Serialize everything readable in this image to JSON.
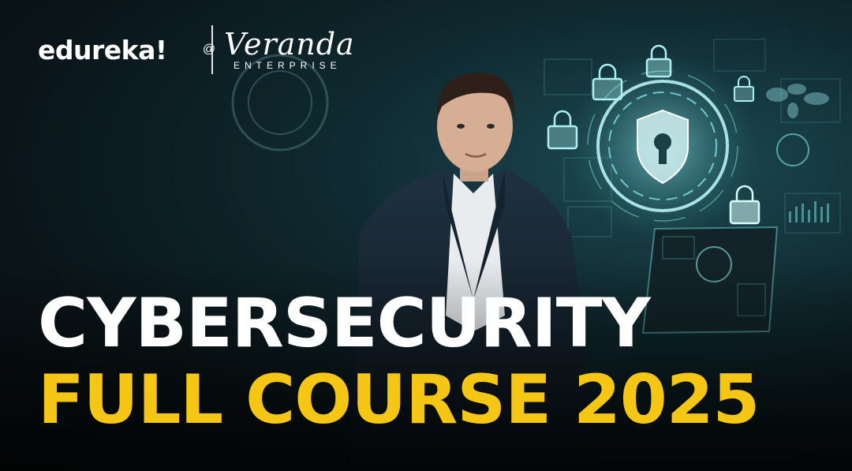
{
  "logos": {
    "edureka": "edureka!",
    "at_symbol": "@",
    "veranda": "Veranda",
    "enterprise": "ENTERPRISE"
  },
  "headline": {
    "line1": "CYBERSECURITY",
    "line2": "FULL COURSE 2025"
  },
  "colors": {
    "accent_yellow": "#f6c614",
    "text_white": "#ffffff",
    "background_dark": "#0a1519",
    "hologram_cyan": "#7fe6ea"
  },
  "icons": [
    "shield-keyhole-icon",
    "padlock-icon",
    "world-map-icon",
    "laptop-icon"
  ]
}
